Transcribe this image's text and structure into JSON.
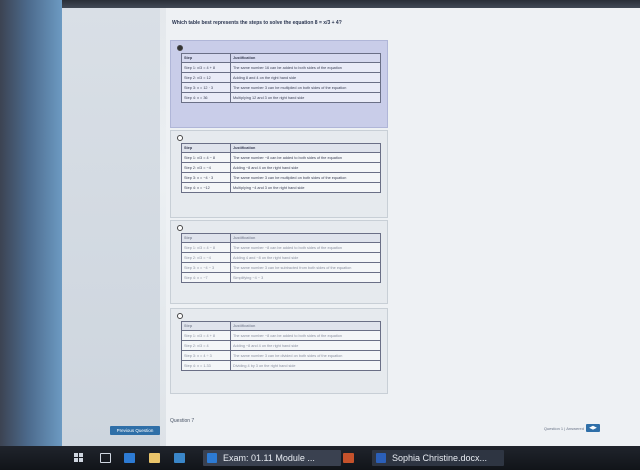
{
  "question": "Which table best represents the steps to solve the equation 8 = x/3 + 4?",
  "headers": {
    "step": "Step",
    "justification": "Justification"
  },
  "options": [
    {
      "id": "A",
      "selected": true,
      "rows": [
        {
          "step": "Step 1: x/3 = 4 + 8",
          "justification": "The same number 16 can be added to both sides of the equation"
        },
        {
          "step": "Step 2: x/3 = 12",
          "justification": "Adding 8 and 4 on the right hand side"
        },
        {
          "step": "Step 3: x = 12 · 3",
          "justification": "The same number 3 can be multiplied on both sides of the equation"
        },
        {
          "step": "Step 4: x = 36",
          "justification": "Multiplying 12 and 3 on the right hand side"
        }
      ]
    },
    {
      "id": "B",
      "selected": false,
      "rows": [
        {
          "step": "Step 1: x/3 = 4 − 8",
          "justification": "The same number −8 can be added to both sides of the equation"
        },
        {
          "step": "Step 2: x/3 = −4",
          "justification": "Adding −8 and 4 on the right hand side"
        },
        {
          "step": "Step 3: x = −4 · 3",
          "justification": "The same number 3 can be multiplied on both sides of the equation"
        },
        {
          "step": "Step 4: x = −12",
          "justification": "Multiplying −4 and 3 on the right hand side"
        }
      ]
    },
    {
      "id": "C",
      "selected": false,
      "rows": [
        {
          "step": "Step 1: x/3 = 4 − 8",
          "justification": "The same number −8 can be added to both sides of the equation"
        },
        {
          "step": "Step 2: x/3 = −4",
          "justification": "Adding 4 and −8 on the right hand side"
        },
        {
          "step": "Step 3: x = −4 − 3",
          "justification": "The same number 3 can be subtracted from both sides of the equation"
        },
        {
          "step": "Step 4: x = −7",
          "justification": "Simplifying −4 − 3"
        }
      ]
    },
    {
      "id": "D",
      "selected": false,
      "rows": [
        {
          "step": "Step 1: x/3 = 4 + 8",
          "justification": "The same number −8 can be added to both sides of the equation"
        },
        {
          "step": "Step 2: x/3 = 4",
          "justification": "Adding −8 and 4 on the right hand side"
        },
        {
          "step": "Step 3: x = 4 ÷ 3",
          "justification": "The same number 3 can be divided on both sides of the equation"
        },
        {
          "step": "Step 4: x = 1.33",
          "justification": "Dividing 4 by 3 on the right hand side"
        }
      ]
    }
  ],
  "buttons": {
    "previous": "Previous Question"
  },
  "next_question": "Question 7",
  "nav_info": "Question 1 | Answered",
  "taskbar": {
    "apps": [
      {
        "label": "Exam: 01.11 Module ...",
        "icon": "edge-icon"
      },
      {
        "label": "Sophia Christine.docx...",
        "icon": "word-icon"
      }
    ]
  },
  "colors": {
    "selected": "#c9cde9",
    "accent": "#2f6fa8",
    "taskbar": "#16191f"
  }
}
